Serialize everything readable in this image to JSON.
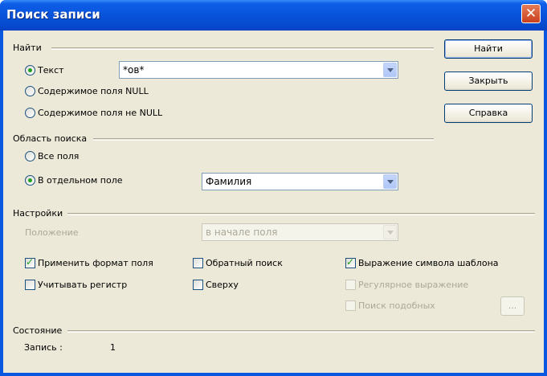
{
  "window": {
    "title": "Поиск записи",
    "close_glyph": "✕"
  },
  "find": {
    "section_label": "Найти",
    "options": [
      {
        "label": "Текст",
        "underline_index": 0,
        "selected": true
      },
      {
        "label": "Содержимое поля NULL",
        "selected": false
      },
      {
        "label": "Содержимое поля не NULL",
        "selected": false
      }
    ],
    "text_value": "*ов*"
  },
  "scope": {
    "section_label": "Область поиска",
    "options": [
      {
        "label": "Все поля",
        "selected": false
      },
      {
        "label": "В отдельном поле",
        "selected": true
      }
    ],
    "field_value": "Фамилия"
  },
  "settings": {
    "section_label": "Настройки",
    "position_label": "Положение",
    "position_value": "в начале поля",
    "checkboxes": [
      {
        "label": "Применить формат поля",
        "checked": true,
        "enabled": true
      },
      {
        "label": "Обратный поиск",
        "checked": false,
        "enabled": true
      },
      {
        "label": "Выражение символа шаблона",
        "checked": true,
        "enabled": true
      },
      {
        "label": "Учитывать регистр",
        "checked": false,
        "enabled": true
      },
      {
        "label": "Сверху",
        "checked": false,
        "enabled": true
      },
      {
        "label": "Регулярное выражение",
        "checked": false,
        "enabled": false
      },
      {
        "label": "Поиск подобных",
        "checked": false,
        "enabled": false
      }
    ],
    "similarity_button": "..."
  },
  "status": {
    "section_label": "Состояние",
    "record_label": "Запись :",
    "record_value": "1"
  },
  "buttons": {
    "find": "Найти",
    "close": "Закрыть",
    "help": "Справка"
  }
}
